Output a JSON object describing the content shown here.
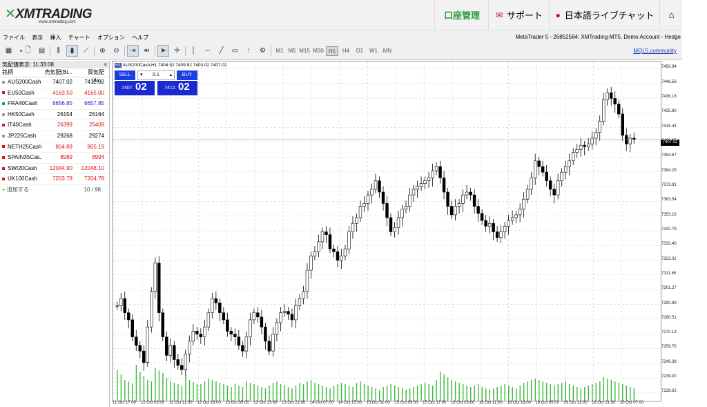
{
  "header": {
    "logo": "XMTRADING",
    "logo_sub": "www.xmtrading.com",
    "account_label": "口座管理",
    "support_label": "サポート",
    "chat_label": "日本語ライブチャット"
  },
  "menu": {
    "items": [
      "ファイル",
      "表示",
      "挿入",
      "チャート",
      "オプション",
      "ヘルプ"
    ],
    "account_info": "MetaTrader 5 - 26852584: XMTrading-MT5, Demo Account - Hedge"
  },
  "toolbar": {
    "timeframes": [
      "M1",
      "M5",
      "M15",
      "M30",
      "H1",
      "H4",
      "D1",
      "W1",
      "MN"
    ],
    "active_timeframe": "H1",
    "mql5_link": "MQL5.community"
  },
  "market_watch": {
    "title": "気配値表示: 11:33:08",
    "close": "×",
    "headers": [
      "銘柄",
      "売気配(Bi...",
      "買気配(As..."
    ],
    "rows": [
      {
        "symbol": "AUS200Cash",
        "bid": "7407.02",
        "ask": "7412.02",
        "color": "#000000",
        "dot": "#999999"
      },
      {
        "symbol": "EU50Cash",
        "bid": "4163.50",
        "ask": "4165.00",
        "color": "#e01010",
        "dot": "#e01010"
      },
      {
        "symbol": "FRA40Cash",
        "bid": "6656.85",
        "ask": "6657.85",
        "color": "#1a1ae0",
        "dot": "#2e9a3c"
      },
      {
        "symbol": "HK50Cash",
        "bid": "26154",
        "ask": "26164",
        "color": "#000000",
        "dot": "#999999"
      },
      {
        "symbol": "IT40Cash",
        "bid": "26399",
        "ask": "26409",
        "color": "#e01010",
        "dot": "#e01010"
      },
      {
        "symbol": "JP225Cash",
        "bid": "29268",
        "ask": "29274",
        "color": "#000000",
        "dot": "#999999"
      },
      {
        "symbol": "NETH25Cash",
        "bid": "804.89",
        "ask": "805.19",
        "color": "#e01010",
        "dot": "#e01010"
      },
      {
        "symbol": "SPAIN35Cas...",
        "bid": "8989",
        "ask": "8994",
        "color": "#e01010",
        "dot": "#e01010"
      },
      {
        "symbol": "SWI20Cash",
        "bid": "12044.90",
        "ask": "12048.10",
        "color": "#e01010",
        "dot": "#e01010"
      },
      {
        "symbol": "UK100Cash",
        "bid": "7203.78",
        "ask": "7204.78",
        "color": "#e01010",
        "dot": "#e01010"
      }
    ],
    "add_label": "追加する",
    "count": "10 / 98"
  },
  "chart": {
    "title": "AUS200Cash,H1  7404.52 7409.52 7403.02 7407.02",
    "symbol_badge": "H1",
    "sell_label": "SELL",
    "buy_label": "BUY",
    "lot": "0.1",
    "bid_small": "7407.",
    "bid_big": "02",
    "ask_small": "7412.",
    "ask_big": "02",
    "current_price": "7407.02"
  },
  "chart_data": {
    "type": "candlestick",
    "y_ticks": [
      "7456.94",
      "7446.56",
      "7436.18",
      "7425.80",
      "7415.43",
      "7405.05",
      "7394.67",
      "7384.29",
      "7373.91",
      "7363.54",
      "7353.16",
      "7342.78",
      "7332.40",
      "7322.02",
      "7311.65",
      "7301.27",
      "7290.89",
      "7280.51",
      "7270.13",
      "7259.76",
      "7249.38",
      "7239.00",
      "7228.62"
    ],
    "x_ticks": [
      "11 Oct 17:00",
      "12 Oct 03:00",
      "12 Oct 11:00",
      "12 Oct 19:00",
      "13 Oct 05:00",
      "13 Oct 13:00",
      "13 Oct 21:00",
      "14 Oct 07:00",
      "14 Oct 15:00",
      "15 Oct 01:00",
      "15 Oct 09:00",
      "15 Oct 17:00",
      "18 Oct 03:00",
      "18 Oct 11:00",
      "18 Oct 19:00",
      "19 Oct 05:00",
      "19 Oct 13:00",
      "19 Oct 21:00",
      "20 Oct 07:00"
    ],
    "ylim": [
      7223,
      7462
    ],
    "closes": [
      7290,
      7295,
      7285,
      7280,
      7268,
      7262,
      7258,
      7250,
      7275,
      7300,
      7320,
      7285,
      7268,
      7255,
      7262,
      7252,
      7248,
      7245,
      7256,
      7265,
      7272,
      7270,
      7268,
      7275,
      7285,
      7295,
      7292,
      7285,
      7280,
      7272,
      7270,
      7268,
      7262,
      7258,
      7268,
      7280,
      7285,
      7282,
      7275,
      7265,
      7258,
      7270,
      7278,
      7285,
      7286,
      7284,
      7280,
      7290,
      7295,
      7300,
      7315,
      7325,
      7328,
      7335,
      7342,
      7340,
      7330,
      7328,
      7322,
      7325,
      7330,
      7342,
      7348,
      7352,
      7360,
      7362,
      7368,
      7372,
      7378,
      7370,
      7362,
      7352,
      7342,
      7345,
      7352,
      7358,
      7360,
      7368,
      7372,
      7374,
      7376,
      7378,
      7380,
      7385,
      7388,
      7380,
      7370,
      7360,
      7354,
      7360,
      7362,
      7368,
      7370,
      7368,
      7360,
      7355,
      7350,
      7346,
      7348,
      7342,
      7338,
      7342,
      7346,
      7350,
      7352,
      7354,
      7358,
      7365,
      7372,
      7380,
      7392,
      7388,
      7384,
      7378,
      7372,
      7368,
      7378,
      7384,
      7388,
      7392,
      7398,
      7400,
      7403,
      7402,
      7404,
      7408,
      7412,
      7420,
      7435,
      7440,
      7436,
      7432,
      7425,
      7410,
      7404,
      7408,
      7407
    ],
    "volumes": [
      45,
      38,
      30,
      28,
      25,
      52,
      42,
      36,
      30,
      28,
      48,
      44,
      40,
      33,
      28,
      26,
      24,
      22,
      35,
      30,
      27,
      25,
      24,
      28,
      32,
      30,
      28,
      26,
      24,
      22,
      20,
      25,
      22,
      20,
      28,
      26,
      24,
      22,
      20,
      18,
      22,
      26,
      28,
      24,
      22,
      20,
      18,
      22,
      26,
      24,
      28,
      30,
      26,
      24,
      22,
      20,
      18,
      22,
      24,
      26,
      24,
      22,
      20,
      26,
      28,
      24,
      22,
      20,
      18,
      16,
      20,
      22,
      24,
      22,
      20,
      18,
      16,
      18,
      20,
      22,
      24,
      26,
      24,
      22,
      30,
      42,
      38,
      34,
      30,
      28,
      26,
      24,
      22,
      20,
      22,
      24,
      20,
      18,
      16,
      18,
      20,
      22,
      24,
      22,
      20,
      18,
      22,
      26,
      28,
      30,
      32,
      30,
      28,
      26,
      24,
      22,
      24,
      26,
      28,
      24,
      22,
      20,
      18,
      20,
      22,
      24,
      26,
      28,
      34,
      32,
      30,
      28,
      26,
      24,
      22,
      20,
      18
    ]
  }
}
